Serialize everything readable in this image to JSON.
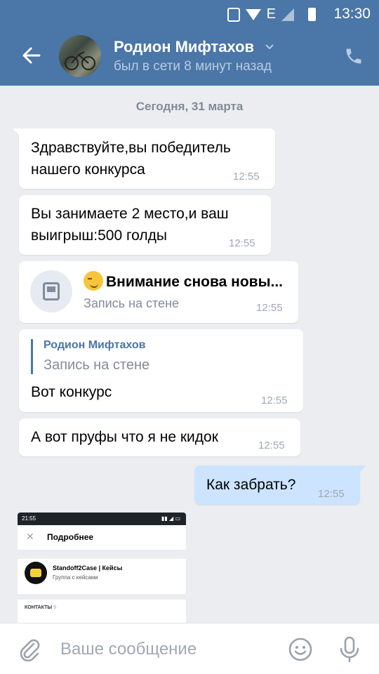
{
  "status_bar": {
    "time": "13:30",
    "network": "E"
  },
  "header": {
    "name": "Родион Мифтахов",
    "status": "был в сети 8 минут назад"
  },
  "chat": {
    "date": "Сегодня, 31 марта",
    "messages": [
      {
        "text_lines": [
          "Здравствуйте,вы победитель",
          "нашего конкурса"
        ],
        "time": "12:55"
      },
      {
        "text_lines": [
          "Вы занимаете 2 место,и ваш",
          "выигрыш:500 голды"
        ],
        "time": "12:55"
      },
      {
        "wall_title": "Внимание снова новы...",
        "wall_subtitle": "Запись на стене",
        "time": "12:55"
      },
      {
        "repost_author": "Родион Мифтахов",
        "repost_subtitle": "Запись на стене",
        "text": "Вот конкурс",
        "time": "12:55"
      },
      {
        "text": "А вот пруфы что я не кидок",
        "time": "12:55"
      },
      {
        "text": "Как забрать?",
        "time": "12:55",
        "outgoing": true
      }
    ],
    "attachment": {
      "status_time": "21:55",
      "panel_title": "Подробнее",
      "group_name": "Standoff2Case | Кейсы",
      "group_subtitle": "Группа с кейсами",
      "section_label": "КОНТАКТЫ",
      "section_count": "6"
    }
  },
  "composer": {
    "placeholder": "Ваше сообщение"
  },
  "colors": {
    "accent": "#4a76a8",
    "outgoing_bubble": "#cce4ff",
    "background": "#ebedf0"
  }
}
